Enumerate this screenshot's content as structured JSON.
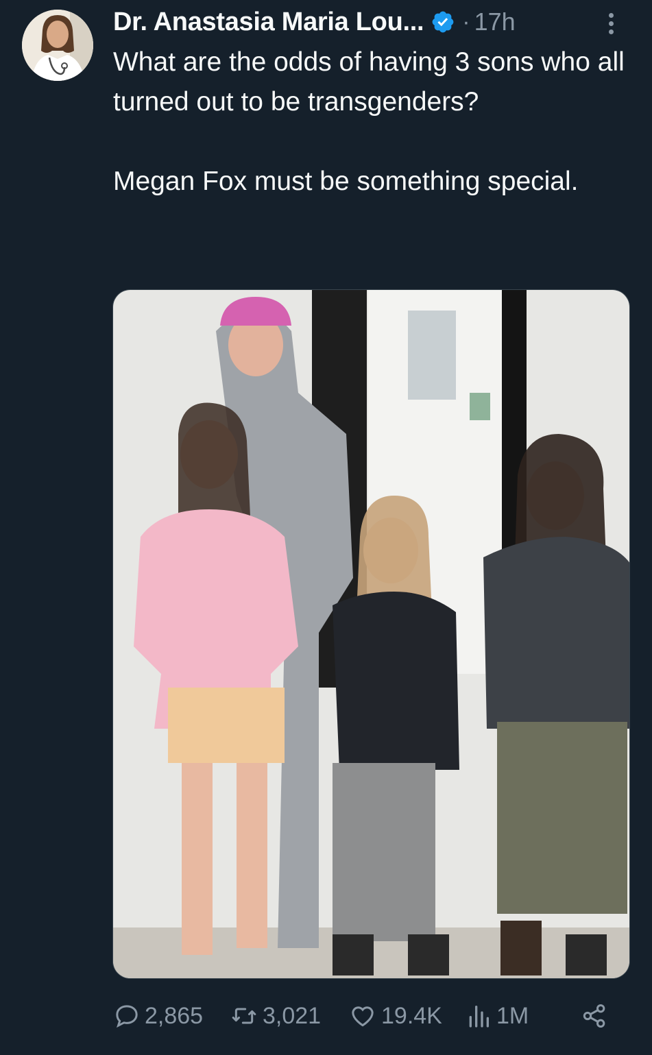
{
  "author": {
    "display_name": "Dr. Anastasia Maria Lou...",
    "verified": true,
    "separator": "·",
    "timestamp": "17h"
  },
  "tweet": {
    "paragraphs": [
      "What are the odds of having 3 sons who all turned out to be transgenders?",
      "Megan Fox must be something special."
    ]
  },
  "media": {
    "kind": "photo"
  },
  "metrics": {
    "replies": "2,865",
    "retweets": "3,021",
    "likes": "19.4K",
    "views": "1M"
  },
  "icons": {
    "reply": "speech-bubble-icon",
    "retweet": "retweet-icon",
    "like": "heart-icon",
    "views": "bar-chart-icon",
    "share": "share-icon",
    "more": "vertical-ellipsis-icon",
    "verified": "verified-badge-icon"
  },
  "colors": {
    "background": "#15202b",
    "text": "#f7f9f9",
    "muted": "#8b98a5",
    "verified": "#1d9bf0"
  }
}
